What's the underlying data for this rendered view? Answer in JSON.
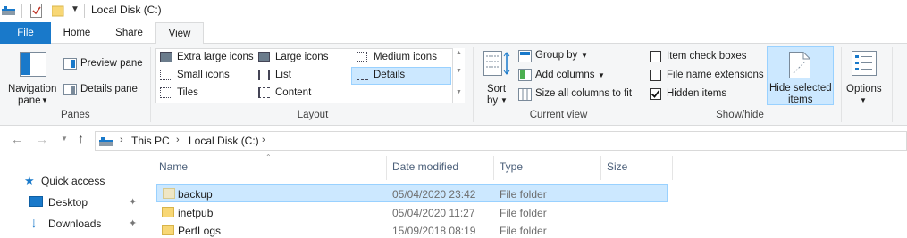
{
  "window": {
    "title": "Local Disk (C:)"
  },
  "tabs": [
    {
      "label": "File"
    },
    {
      "label": "Home"
    },
    {
      "label": "Share"
    },
    {
      "label": "View"
    }
  ],
  "ribbon": {
    "panes": {
      "group_label": "Panes",
      "navigation_pane_line1": "Navigation",
      "navigation_pane_line2": "pane",
      "preview_pane": "Preview pane",
      "details_pane": "Details pane"
    },
    "layout": {
      "group_label": "Layout",
      "items": [
        "Extra large icons",
        "Large icons",
        "Medium icons",
        "Small icons",
        "List",
        "Details",
        "Tiles",
        "Content"
      ],
      "selected": "Details"
    },
    "current_view": {
      "group_label": "Current view",
      "sort_line1": "Sort",
      "sort_line2": "by",
      "group_by": "Group by",
      "add_columns": "Add columns",
      "size_all_columns": "Size all columns to fit"
    },
    "show_hide": {
      "group_label": "Show/hide",
      "item_check_boxes": {
        "label": "Item check boxes",
        "checked": false
      },
      "file_name_extensions": {
        "label": "File name extensions",
        "checked": false
      },
      "hidden_items": {
        "label": "Hidden items",
        "checked": true
      },
      "hide_selected_line1": "Hide selected",
      "hide_selected_line2": "items"
    },
    "options": {
      "label": "Options"
    }
  },
  "address": {
    "breadcrumb": [
      "This PC",
      "Local Disk (C:)"
    ]
  },
  "nav_pane": {
    "items": [
      {
        "label": "Quick access"
      },
      {
        "label": "Desktop"
      },
      {
        "label": "Downloads"
      }
    ]
  },
  "columns": [
    "Name",
    "Date modified",
    "Type",
    "Size"
  ],
  "files": [
    {
      "name": "backup",
      "modified": "05/04/2020 23:42",
      "type": "File folder",
      "size": ""
    },
    {
      "name": "inetpub",
      "modified": "05/04/2020 11:27",
      "type": "File folder",
      "size": ""
    },
    {
      "name": "PerfLogs",
      "modified": "15/09/2018 08:19",
      "type": "File folder",
      "size": ""
    }
  ],
  "colors": {
    "accent": "#1979ca",
    "selection": "#cce8ff",
    "selection_border": "#99d1ff",
    "folder": "#f8d775"
  }
}
